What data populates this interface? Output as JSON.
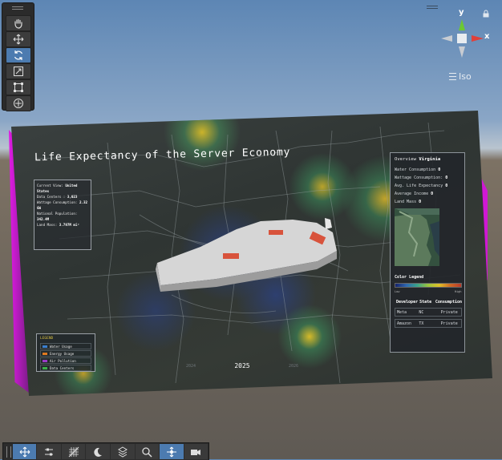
{
  "gizmo": {
    "axis_y": "y",
    "axis_x": "x",
    "view_mode": "Iso"
  },
  "map": {
    "title": "Life Expectancy of the Server Economy",
    "info_panel": {
      "current_view_label": "Current View:",
      "current_view_value": "United States",
      "data_centers_label": "Data Centers :",
      "data_centers_value": "3,023",
      "wattage_label": "Wattage Consumption:",
      "wattage_value": "2.32 GW",
      "population_label": "National Population:",
      "population_value": "342.4M",
      "land_mass_label": "Land Mass:",
      "land_mass_value": "3.797M mi²"
    },
    "legend": {
      "title": "LEGEND",
      "items": [
        {
          "label": "Water Usage",
          "color": "#3a7fd0"
        },
        {
          "label": "Energy Usage",
          "color": "#e07a20"
        },
        {
          "label": "Air Pollution",
          "color": "#9a3ac8"
        },
        {
          "label": "Data Centers",
          "color": "#3cb04a"
        }
      ]
    },
    "timeline": {
      "prev": "2024",
      "current": "2025",
      "next": "2026"
    }
  },
  "overview": {
    "label": "Overview",
    "state": "Virginia",
    "rows": [
      {
        "label": "Water Consumption",
        "value": "0"
      },
      {
        "label": "Wattage Consumption:",
        "value": "0"
      },
      {
        "label": "Avg. Life Expectancy",
        "value": "0"
      },
      {
        "label": "Average Income",
        "value": "0"
      },
      {
        "label": "Land Mass",
        "value": "0"
      }
    ],
    "color_legend_title": "Color Legend",
    "low": "Low",
    "high": "High",
    "table_headers": [
      "Developer",
      "State",
      "Consumption"
    ],
    "table_rows": [
      [
        "Meta",
        "NC",
        "Private"
      ],
      [
        "Amazon",
        "TX",
        "Private"
      ]
    ]
  }
}
